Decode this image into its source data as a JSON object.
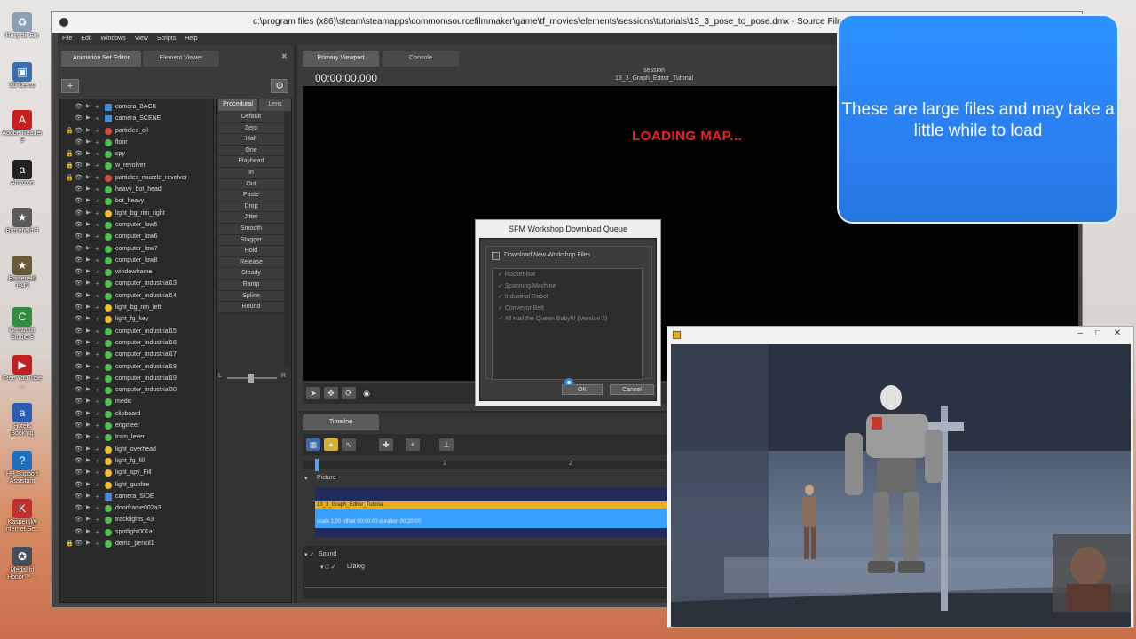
{
  "desktop_icons": [
    {
      "label": "Recycle Bin",
      "color": "#8aa0b8"
    },
    {
      "label": "3D Demo",
      "color": "#3b6fb0"
    },
    {
      "label": "Adobe Reader 9",
      "color": "#c8201c"
    },
    {
      "label": "Amazon",
      "color": "#222222"
    },
    {
      "label": "Battlefield 3",
      "color": "#5a5a5a"
    },
    {
      "label": "Battlefield 1942",
      "color": "#6a5a3a"
    },
    {
      "label": "Camtasia Studio 8",
      "color": "#2f8f3f"
    },
    {
      "label": "Free YouTube ...",
      "color": "#c02020"
    },
    {
      "label": "Hotels Booking",
      "color": "#2a5cb8"
    },
    {
      "label": "HP Support Assistant",
      "color": "#1d6fc0"
    },
    {
      "label": "Kaspersky Internet Se...",
      "color": "#c03030"
    },
    {
      "label": "Medal of Honor™ ...",
      "color": "#44505a"
    }
  ],
  "window": {
    "title": "c:\\program files (x86)\\steam\\steamapps\\common\\sourcefilmmaker\\game\\tf_movies\\elements\\sessions\\tutorials\\13_3_pose_to_pose.dmx - Source Filmma"
  },
  "menu": [
    "File",
    "Edit",
    "Windows",
    "View",
    "Scripts",
    "Help"
  ],
  "left_tabs": {
    "animation_set_editor": "Animation Set Editor",
    "element_viewer": "Element Viewer"
  },
  "add_symbol": "+",
  "gear_symbol": "⚙",
  "tree": [
    {
      "label": "camera_BACK",
      "type": "cam",
      "lock": false
    },
    {
      "label": "camera_SCENE",
      "type": "cam",
      "lock": false
    },
    {
      "label": "particles_oil",
      "type": "part",
      "lock": true
    },
    {
      "label": "floor",
      "type": "model",
      "lock": false
    },
    {
      "label": "spy",
      "type": "model",
      "lock": true
    },
    {
      "label": "w_revolver",
      "type": "model",
      "lock": true
    },
    {
      "label": "particles_muzzle_revolver",
      "type": "part",
      "lock": true
    },
    {
      "label": "heavy_bot_head",
      "type": "model",
      "lock": false
    },
    {
      "label": "bot_heavy",
      "type": "model",
      "lock": false
    },
    {
      "label": "light_bg_rim_right",
      "type": "light",
      "lock": false
    },
    {
      "label": "computer_low5",
      "type": "model",
      "lock": false
    },
    {
      "label": "computer_low6",
      "type": "model",
      "lock": false
    },
    {
      "label": "computer_low7",
      "type": "model",
      "lock": false
    },
    {
      "label": "computer_low8",
      "type": "model",
      "lock": false
    },
    {
      "label": "windowframe",
      "type": "model",
      "lock": false
    },
    {
      "label": "computer_industrial13",
      "type": "model",
      "lock": false
    },
    {
      "label": "computer_industrial14",
      "type": "model",
      "lock": false
    },
    {
      "label": "light_bg_rim_left",
      "type": "light",
      "lock": false
    },
    {
      "label": "light_fg_key",
      "type": "light",
      "lock": false
    },
    {
      "label": "computer_industrial15",
      "type": "model",
      "lock": false
    },
    {
      "label": "computer_industrial16",
      "type": "model",
      "lock": false
    },
    {
      "label": "computer_industrial17",
      "type": "model",
      "lock": false
    },
    {
      "label": "computer_industrial18",
      "type": "model",
      "lock": false
    },
    {
      "label": "computer_industrial19",
      "type": "model",
      "lock": false
    },
    {
      "label": "computer_industrial20",
      "type": "model",
      "lock": false
    },
    {
      "label": "medic",
      "type": "model",
      "lock": false
    },
    {
      "label": "clipboard",
      "type": "model",
      "lock": false
    },
    {
      "label": "engineer",
      "type": "model",
      "lock": false
    },
    {
      "label": "tram_lever",
      "type": "model",
      "lock": false
    },
    {
      "label": "light_overhead",
      "type": "light",
      "lock": false
    },
    {
      "label": "light_fg_fill",
      "type": "light",
      "lock": false
    },
    {
      "label": "light_spy_Fill",
      "type": "light",
      "lock": false
    },
    {
      "label": "light_gunfire",
      "type": "light",
      "lock": false
    },
    {
      "label": "camera_SIDE",
      "type": "cam",
      "lock": false
    },
    {
      "label": "doorframe002a3",
      "type": "model",
      "lock": false
    },
    {
      "label": "tracklights_43",
      "type": "model",
      "lock": false
    },
    {
      "label": "spotlight001a1",
      "type": "model",
      "lock": false
    },
    {
      "label": "demo_pencil1",
      "type": "model",
      "lock": true
    }
  ],
  "preset_tabs": {
    "procedural": "Procedural",
    "lens": "Lens"
  },
  "presets": [
    "Default",
    "Zero",
    "Half",
    "One",
    "Playhead",
    "In",
    "Out",
    "Paste",
    "Drop",
    "Jitter",
    "Smooth",
    "Stagger",
    "Hold",
    "Release",
    "Steady",
    "Ramp",
    "Spline",
    "Round"
  ],
  "balance": {
    "left": "L",
    "right": "R"
  },
  "viewport": {
    "tab_primary": "Primary Viewport",
    "tab_console": "Console",
    "timecode": "00:00:00.000",
    "session_label": "session",
    "session_name": "13_3_Graph_Editor_Tutorial",
    "loading_text": "LOADING MAP..."
  },
  "timeline": {
    "tab": "Timeline",
    "ruler_marks": [
      "1",
      "2"
    ],
    "picture_label": "Picture",
    "clip_name": "13_3_Graph_Editor_Tutorial",
    "clip_info": "scale 1.00  offset  00:00:00  duration  00:20:00",
    "sound_label": "Sound",
    "dialog_label": "Dialog"
  },
  "download_dialog": {
    "title": "SFM Workshop Download Queue",
    "checkbox_label": "Download New Workshop Files",
    "items": [
      "Rocket Bot",
      "Scanning Machine",
      "Industrial Robot",
      "Conveyor Belt",
      "All Hail the Queen Baby!!! (Version 2)"
    ],
    "ok": "OK",
    "cancel": "Cancel"
  },
  "callout": {
    "text": "These are large files and may take a little while to load"
  },
  "preview_window": {
    "minimize": "–",
    "maximize": "□",
    "close": "✕"
  }
}
